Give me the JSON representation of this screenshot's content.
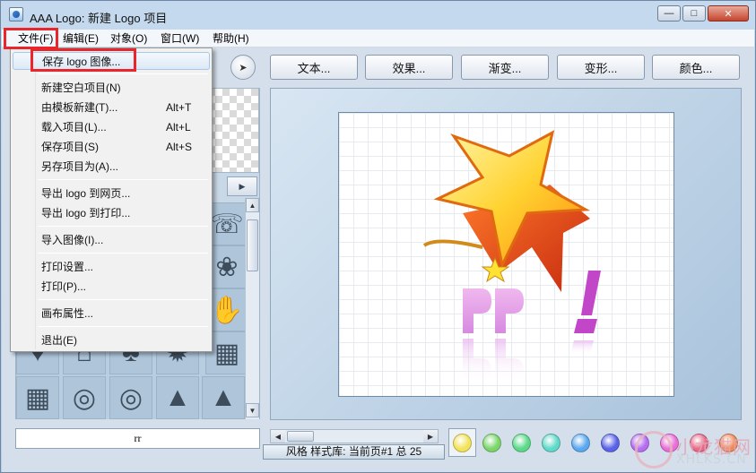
{
  "window": {
    "title": "AAA Logo: 新建 Logo 项目"
  },
  "menubar": [
    {
      "label": "文件(F)"
    },
    {
      "label": "编辑(E)"
    },
    {
      "label": "对象(O)"
    },
    {
      "label": "窗口(W)"
    },
    {
      "label": "帮助(H)"
    }
  ],
  "toolbar": {
    "buttons": [
      "文本...",
      "效果...",
      "渐变...",
      "变形...",
      "颜色..."
    ]
  },
  "file_menu": {
    "items": [
      {
        "label": "保存 logo 图像...",
        "shortcut": ""
      },
      {
        "label": "新建空白项目(N)",
        "shortcut": ""
      },
      {
        "label": "由模板新建(T)...",
        "shortcut": "Alt+T"
      },
      {
        "label": "载入项目(L)...",
        "shortcut": "Alt+L"
      },
      {
        "label": "保存项目(S)",
        "shortcut": "Alt+S"
      },
      {
        "label": "另存项目为(A)...",
        "shortcut": ""
      },
      {
        "label": "导出 logo 到网页...",
        "shortcut": ""
      },
      {
        "label": "导出 logo 到打印...",
        "shortcut": ""
      },
      {
        "label": "导入图像(I)...",
        "shortcut": ""
      },
      {
        "label": "打印设置...",
        "shortcut": ""
      },
      {
        "label": "打印(P)...",
        "shortcut": ""
      },
      {
        "label": "画布属性...",
        "shortcut": ""
      },
      {
        "label": "退出(E)",
        "shortcut": ""
      }
    ]
  },
  "text_input": {
    "value": "rr"
  },
  "status": {
    "text": "风格 样式库: 当前页#1 总 25"
  },
  "palette": [
    "#f2e35a",
    "#7bd66a",
    "#5bd98a",
    "#5fd9c9",
    "#5ba8ee",
    "#5a63e6",
    "#b56ef0",
    "#e86fd6",
    "#e86a8a",
    "#ee8a5a"
  ],
  "watermark": {
    "line1": "小龙猫网",
    "line2": "XHLKS.CN"
  }
}
